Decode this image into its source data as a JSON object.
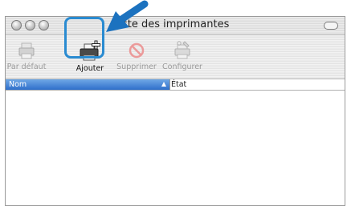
{
  "window": {
    "title": "Liste des imprimantes",
    "title_visible": "ste des imprimantes"
  },
  "toolbar": {
    "items": [
      {
        "label": "Par défaut",
        "icon": "printer-default-icon",
        "enabled": false
      },
      {
        "label": "Ajouter",
        "icon": "add-printer-icon",
        "enabled": true,
        "highlighted": true
      },
      {
        "label": "Supprimer",
        "icon": "delete-icon",
        "enabled": false
      },
      {
        "label": "Configurer",
        "icon": "configure-icon",
        "enabled": false
      }
    ]
  },
  "table": {
    "columns": [
      {
        "label": "Nom",
        "sorted": true
      },
      {
        "label": "État"
      }
    ],
    "rows": []
  },
  "colors": {
    "accent": "#2a8bd1",
    "header_selected": "#3f7fd6"
  }
}
